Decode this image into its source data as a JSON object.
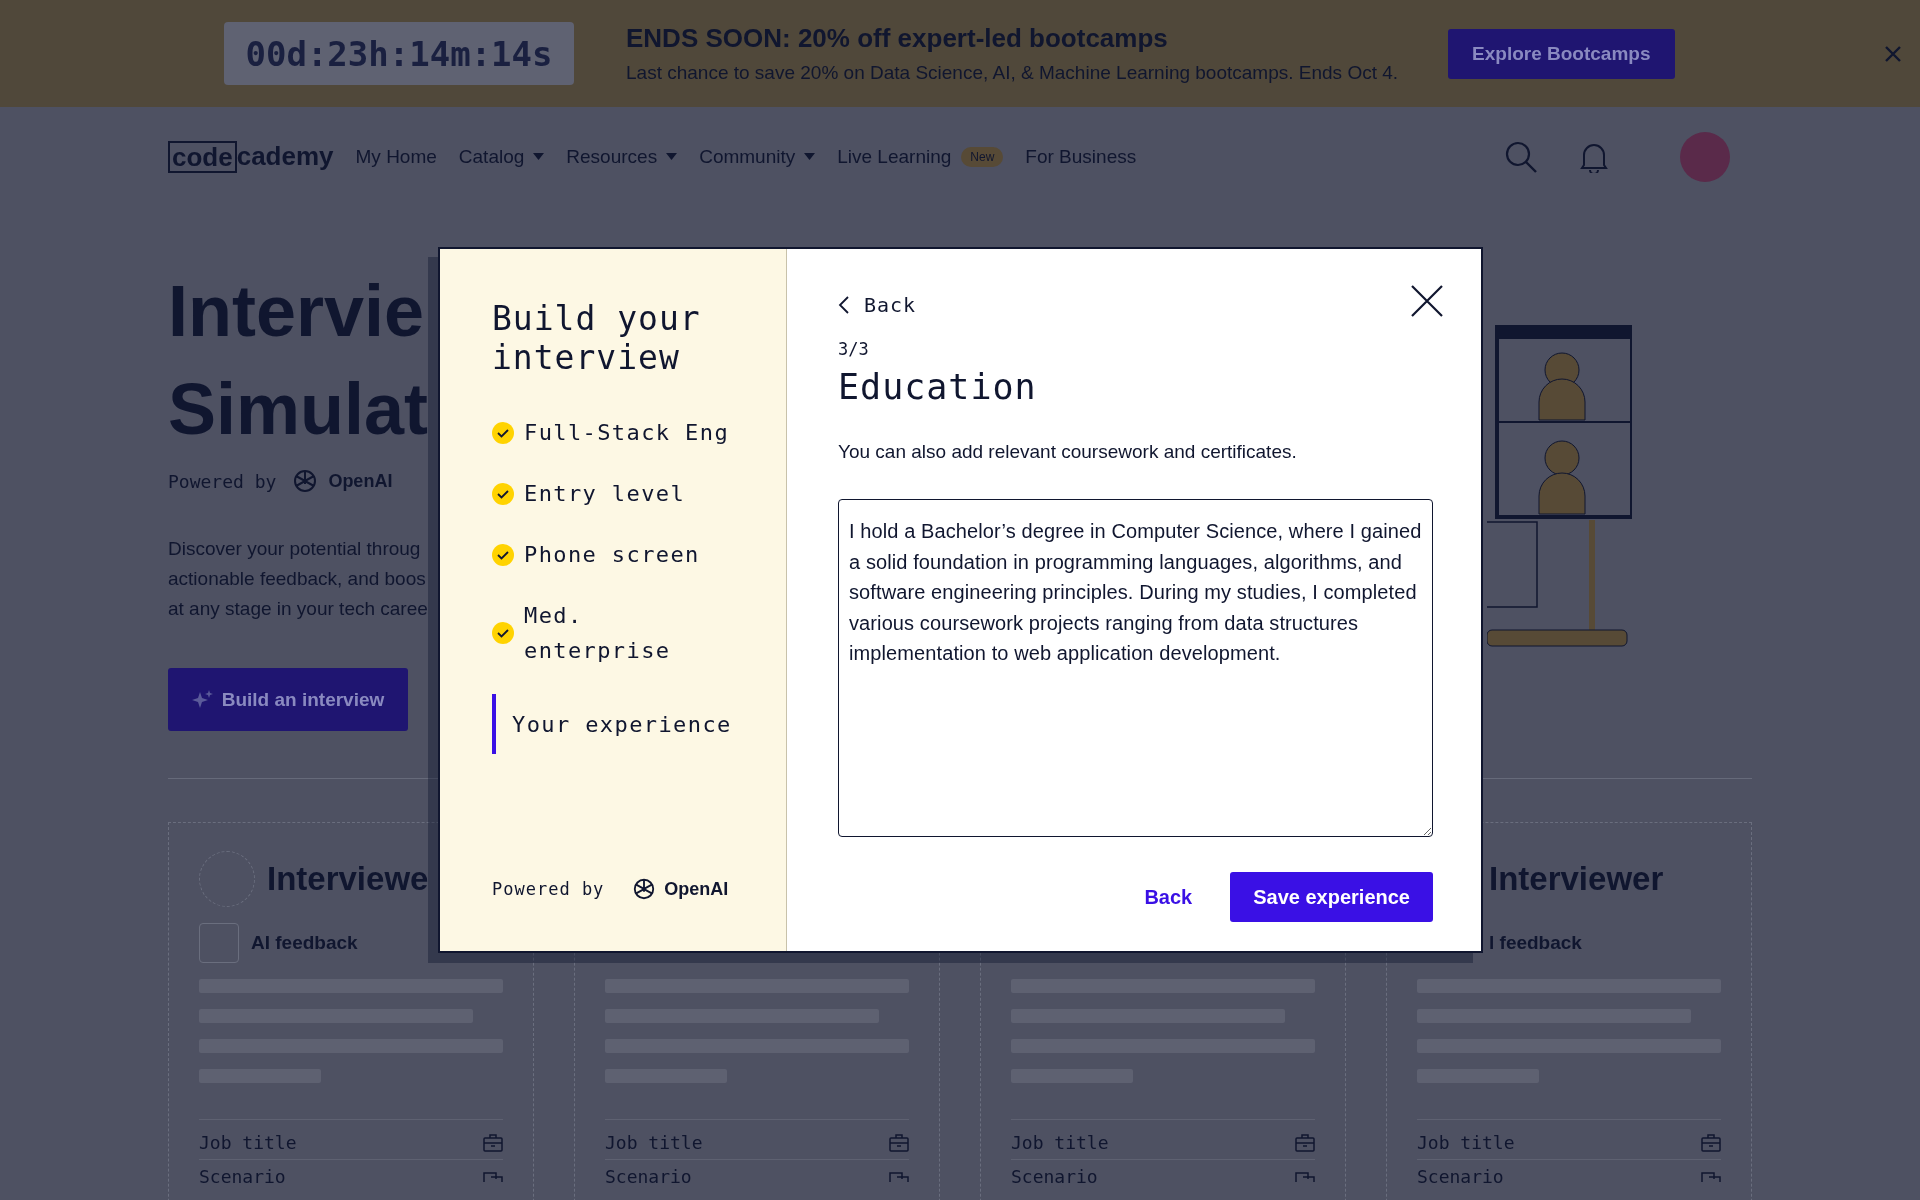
{
  "banner": {
    "countdown": "00d:23h:14m:14s",
    "title": "ENDS SOON: 20% off expert-led bootcamps",
    "subtitle": "Last chance to save 20% on Data Science, AI, & Machine Learning bootcamps. Ends Oct 4.",
    "button": "Explore Bootcamps"
  },
  "nav": {
    "logo": [
      "code",
      "cademy"
    ],
    "items": [
      {
        "label": "My Home",
        "dropdown": false
      },
      {
        "label": "Catalog",
        "dropdown": true
      },
      {
        "label": "Resources",
        "dropdown": true
      },
      {
        "label": "Community",
        "dropdown": true
      },
      {
        "label": "Live Learning",
        "dropdown": false,
        "badge": "New"
      },
      {
        "label": "For Business",
        "dropdown": false
      }
    ]
  },
  "hero": {
    "title_lines": [
      "Intervie",
      "Simulat"
    ],
    "powered_by": "Powered by",
    "brand": "OpenAI",
    "description_lines": [
      "Discover your potential throug",
      "actionable feedback, and boos",
      "at any stage in your tech caree"
    ],
    "button": "Build an interview"
  },
  "cards": [
    {
      "title": "Interviewe",
      "feedback": "AI feedback",
      "icons": true,
      "fields": [
        "Job title",
        "Scenario"
      ]
    },
    {
      "icons": false,
      "fields": [
        "Job title",
        "Scenario"
      ]
    },
    {
      "icons": false,
      "fields": [
        "Job title",
        "Scenario"
      ]
    },
    {
      "title": "Interviewer",
      "feedback": "l feedback",
      "icons": false,
      "fields": [
        "Job title",
        "Scenario"
      ]
    }
  ],
  "modal": {
    "title": "Build your interview",
    "steps": [
      {
        "label": "Full-Stack Eng",
        "done": true,
        "selected": false
      },
      {
        "label": "Entry level",
        "done": true,
        "selected": false
      },
      {
        "label": "Phone screen",
        "done": true,
        "selected": false
      },
      {
        "label": "Med. enterprise",
        "done": true,
        "selected": false
      },
      {
        "label": "Your experience",
        "done": false,
        "selected": true
      }
    ],
    "powered_by": "Powered by",
    "brand": "OpenAI",
    "back_link": "Back",
    "step_count": "3/3",
    "heading": "Education",
    "description": "You can also add relevant coursework and certificates.",
    "answer": "I hold a Bachelor’s degree in Computer Science, where I gained a solid foundation in programming languages, algorithms, and software engineering principles. During my studies, I completed various coursework projects ranging from data structures implementation to web application development.",
    "back_button": "Back",
    "save_button": "Save experience"
  }
}
